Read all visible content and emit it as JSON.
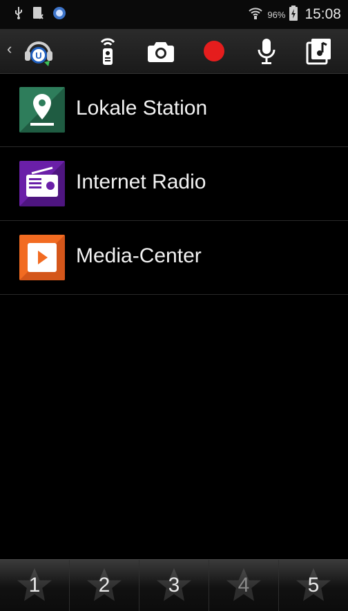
{
  "status_bar": {
    "battery_percent": "96%",
    "time": "15:08",
    "icons": [
      "usb-icon",
      "sim-icon",
      "app-notification-icon",
      "wifi-icon",
      "battery-icon"
    ]
  },
  "toolbar": {
    "icons": [
      "back-chevron-icon",
      "app-logo-icon",
      "remote-icon",
      "camera-icon",
      "record-icon",
      "microphone-icon",
      "music-icon"
    ],
    "accent": "#e51d1d"
  },
  "menu": {
    "items": [
      {
        "label": "Lokale Station",
        "icon": "location-pin-icon",
        "color": "#2e7d5b"
      },
      {
        "label": "Internet Radio",
        "icon": "radio-icon",
        "color": "#6a1fa8"
      },
      {
        "label": "Media-Center",
        "icon": "play-icon",
        "color": "#f26b21"
      }
    ]
  },
  "tabs": [
    "1",
    "2",
    "3",
    "4",
    "5"
  ]
}
